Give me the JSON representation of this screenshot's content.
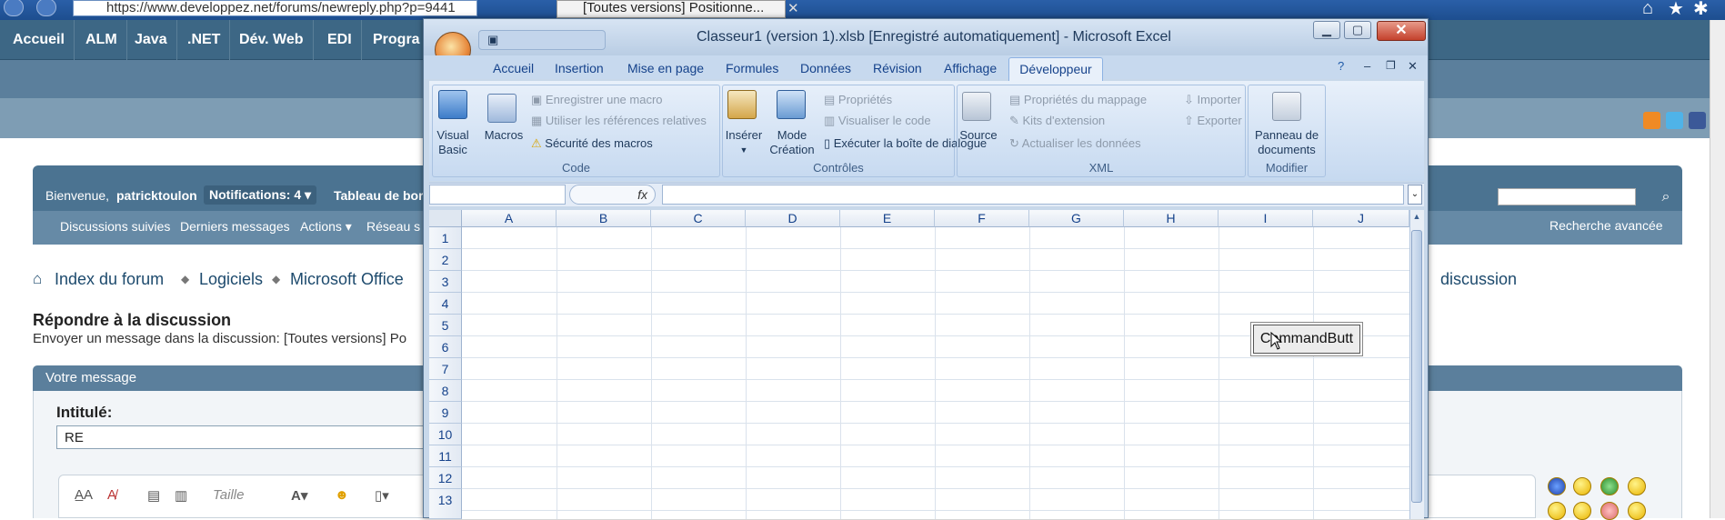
{
  "browser": {
    "url": "https://www.developpez.net/forums/newreply.php?p=9441",
    "tab_title": "[Toutes versions] Positionne..."
  },
  "forum": {
    "nav": [
      "Accueil",
      "ALM",
      "Java",
      ".NET",
      "Dév. Web",
      "EDI",
      "Progra"
    ],
    "welcome_label": "Bienvenue,",
    "username": "patricktoulon",
    "notifications": "Notifications: 4",
    "dashboard": "Tableau de bor",
    "subnav": [
      "Discussions suivies",
      "Derniers messages",
      "Actions",
      "Réseau s"
    ],
    "advanced_search": "Recherche avancée",
    "breadcrumb": [
      "Index du forum",
      "Logiciels",
      "Microsoft Office"
    ],
    "breadcrumb_end": "discussion",
    "reply_title": "Répondre à la discussion",
    "reply_subtitle": "Envoyer un message dans la discussion: [Toutes versions] Po",
    "message_header": "Votre message",
    "title_label": "Intitulé:",
    "title_value": "RE",
    "editor_size_label": "Taille"
  },
  "excel": {
    "window_title": "Classeur1 (version 1).xlsb [Enregistré automatiquement] - Microsoft Excel",
    "tabs": [
      "Accueil",
      "Insertion",
      "Mise en page",
      "Formules",
      "Données",
      "Révision",
      "Affichage"
    ],
    "active_tab": "Développeur",
    "groups": {
      "code": {
        "name": "Code",
        "visual_basic": [
          "Visual",
          "Basic"
        ],
        "macros": "Macros",
        "record_macro": "Enregistrer une macro",
        "relative_refs": "Utiliser les références relatives",
        "macro_security": "Sécurité des macros"
      },
      "controls": {
        "name": "Contrôles",
        "insert": "Insérer",
        "design_mode": [
          "Mode",
          "Création"
        ],
        "properties": "Propriétés",
        "view_code": "Visualiser le code",
        "run_dialog": "Exécuter la boîte de dialogue"
      },
      "xml": {
        "name": "XML",
        "source": "Source",
        "map_properties": "Propriétés du mappage",
        "expansion_packs": "Kits d'extension",
        "refresh_data": "Actualiser les données",
        "import": "Importer",
        "export": "Exporter"
      },
      "modify": {
        "name": "Modifier",
        "doc_panel": [
          "Panneau de",
          "documents"
        ]
      }
    },
    "fx_label": "fx",
    "columns": [
      "A",
      "B",
      "C",
      "D",
      "E",
      "F",
      "G",
      "H",
      "I",
      "J"
    ],
    "rows": [
      "1",
      "2",
      "3",
      "4",
      "5",
      "6",
      "7",
      "8",
      "9",
      "10",
      "11",
      "12",
      "13"
    ],
    "command_button": "CommandButt"
  },
  "colors": {
    "forum_nav": "#3d6785",
    "excel_ribbon": "#d3e2f4",
    "excel_accent": "#15428b"
  }
}
